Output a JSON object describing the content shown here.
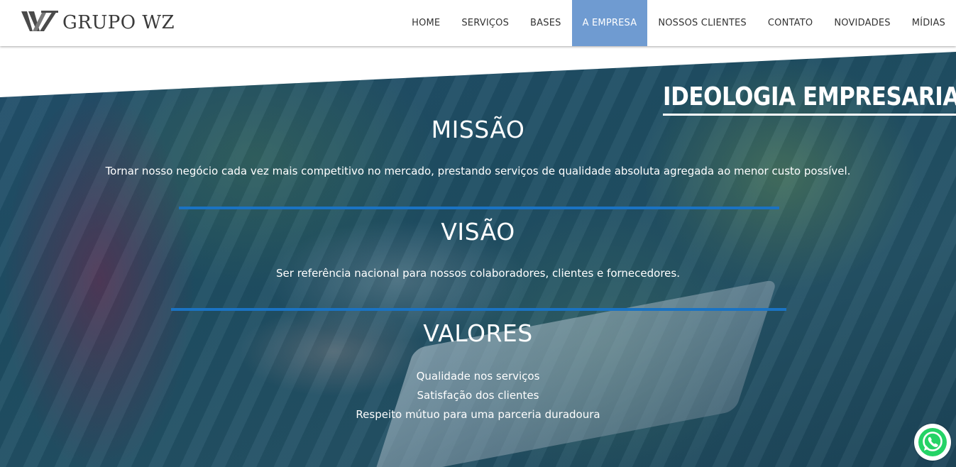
{
  "brand": {
    "logo_text": "GRUPO WZ"
  },
  "nav": {
    "items": [
      {
        "label": "HOME"
      },
      {
        "label": "SERVIÇOS"
      },
      {
        "label": "BASES"
      },
      {
        "label": "A EMPRESA"
      },
      {
        "label": "NOSSOS CLIENTES"
      },
      {
        "label": "CONTATO"
      },
      {
        "label": "NOVIDADES"
      },
      {
        "label": "MÍDIAS"
      }
    ],
    "active_index": 3
  },
  "hero": {
    "title": "IDEOLOGIA EMPRESARIAL",
    "missao": {
      "heading": "MISSÃO",
      "text": "Tornar nosso negócio cada vez mais competitivo no mercado, prestando serviços de qualidade absoluta agregada ao menor custo possível."
    },
    "visao": {
      "heading": "VISÃO",
      "text": "Ser referência nacional para nossos colaboradores, clientes e fornecedores."
    },
    "valores": {
      "heading": "VALORES",
      "items": [
        "Qualidade nos serviços",
        "Satisfação dos clientes",
        "Respeito mútuo para uma parceria duradoura"
      ]
    }
  },
  "icons": {
    "whatsapp": "whatsapp-icon",
    "logo": "wz-logo-icon"
  },
  "colors": {
    "nav_active_bg": "#6f9bd1",
    "divider": "#1a73c3",
    "whatsapp_green": "#25d366"
  }
}
